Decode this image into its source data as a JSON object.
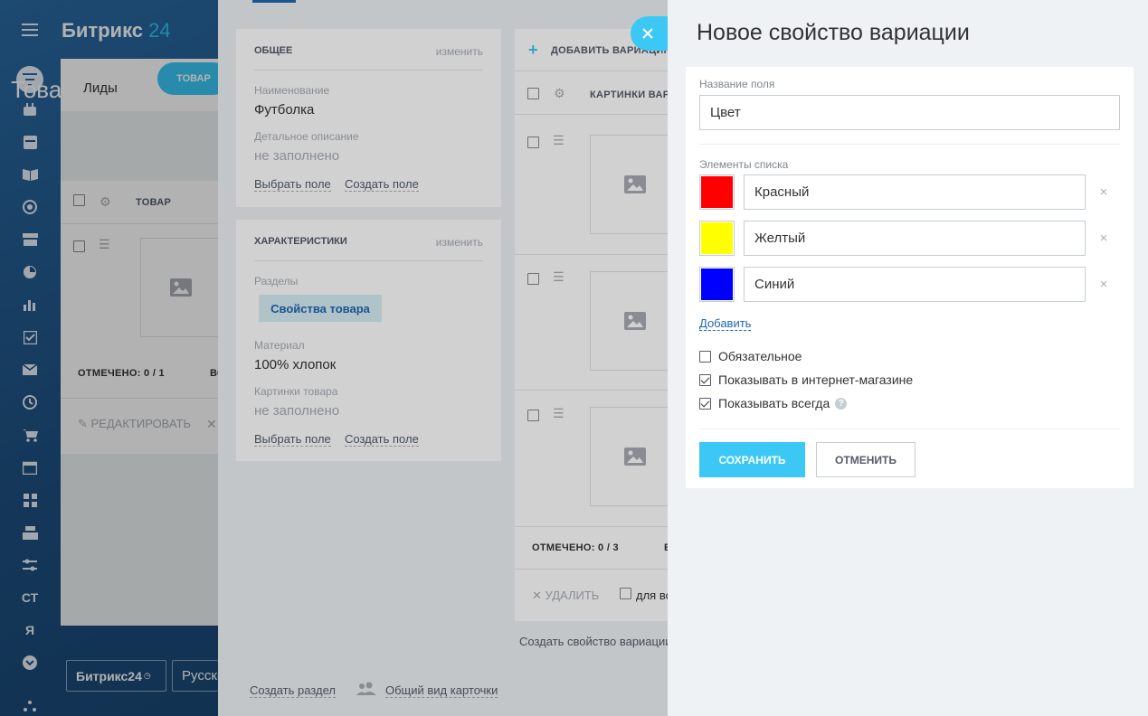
{
  "portal": {
    "logo_name": "Битрикс",
    "logo_num": "24",
    "tab_leads": "Лиды",
    "tab_product": "ТОВАР",
    "title": "Товарный каталог",
    "grid_col_product": "ТОВАР",
    "selected": "ОТМЕЧЕНО: 0 / 1",
    "selected_extra": "ВС",
    "edit": "РЕДАКТИРОВАТЬ",
    "bottom_logo": "Битрикс24",
    "bottom_lang": "Русский",
    "sidebar_text_items": [
      "СТ",
      "Я"
    ]
  },
  "product_card": {
    "general": {
      "title": "ОБЩЕЕ",
      "edit": "изменить",
      "name_label": "Наименование",
      "name_value": "Футболка",
      "desc_label": "Детальное описание",
      "desc_value": "не заполнено",
      "choose_field": "Выбрать поле",
      "create_field": "Создать поле"
    },
    "characteristics": {
      "title": "ХАРАКТЕРИСТИКИ",
      "edit": "изменить",
      "sections_label": "Разделы",
      "section_tag": "Свойства товара",
      "material_label": "Материал",
      "material_value": "100% хлопок",
      "pictures_label": "Картинки товара",
      "pictures_value": "не заполнено",
      "choose_field": "Выбрать поле",
      "create_field": "Создать поле"
    },
    "variations": {
      "add": "ДОБАВИТЬ ВАРИАЦИЮ",
      "col_pictures": "КАРТИНКИ ВАРИАЦИИ",
      "selected": "ОТМЕЧЕНО: 0 / 3",
      "selected_extra": "ВС",
      "delete": "УДАЛИТЬ",
      "for_all": "для всех",
      "create_property": "Создать свойство вариации"
    },
    "create_section": "Создать раздел",
    "card_view": "Общий вид карточки"
  },
  "form": {
    "title": "Новое свойство вариации",
    "field_name_label": "Название поля",
    "field_name_value": "Цвет",
    "list_label": "Элементы списка",
    "items": [
      {
        "color": "#ff0000",
        "value": "Красный"
      },
      {
        "color": "#ffff00",
        "value": "Желтый"
      },
      {
        "color": "#0000ff",
        "value": "Синий"
      }
    ],
    "remove_glyph": "×",
    "add_link": "Добавить",
    "checkbox_required": "Обязательное",
    "checkbox_show_shop": "Показывать в интернет-магазине",
    "checkbox_show_always": "Показывать всегда",
    "help_glyph": "?",
    "save": "СОХРАНИТЬ",
    "cancel": "ОТМЕНИТЬ",
    "required_checked": false,
    "show_shop_checked": true,
    "show_always_checked": true
  },
  "colors": {
    "accent": "#3bc8f5",
    "link": "#2067b0",
    "panel_bg": "#eef2f4"
  }
}
